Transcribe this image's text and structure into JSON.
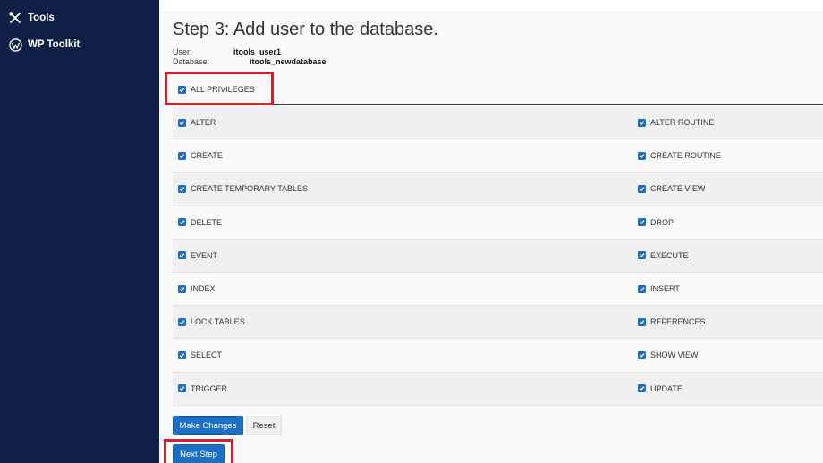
{
  "sidebar": {
    "items": [
      {
        "label": "Tools",
        "icon": "tools-icon"
      },
      {
        "label": "WP Toolkit",
        "icon": "wordpress-icon"
      }
    ]
  },
  "page": {
    "title": "Step 3: Add user to the database.",
    "user_label": "User:",
    "user_value": "itools_user1",
    "database_label": "Database:",
    "database_value": "itools_newdatabase"
  },
  "all_privileges": {
    "label": "ALL PRIVILEGES",
    "checked": true
  },
  "privileges": [
    [
      "ALTER",
      "ALTER ROUTINE"
    ],
    [
      "CREATE",
      "CREATE ROUTINE"
    ],
    [
      "CREATE TEMPORARY TABLES",
      "CREATE VIEW"
    ],
    [
      "DELETE",
      "DROP"
    ],
    [
      "EVENT",
      "EXECUTE"
    ],
    [
      "INDEX",
      "INSERT"
    ],
    [
      "LOCK TABLES",
      "REFERENCES"
    ],
    [
      "SELECT",
      "SHOW VIEW"
    ],
    [
      "TRIGGER",
      "UPDATE"
    ]
  ],
  "buttons": {
    "make_changes": "Make Changes",
    "reset": "Reset",
    "next_step": "Next Step"
  },
  "colors": {
    "sidebar_bg": "#0f1f45",
    "accent": "#1d6fc4",
    "highlight": "#d3202a"
  }
}
